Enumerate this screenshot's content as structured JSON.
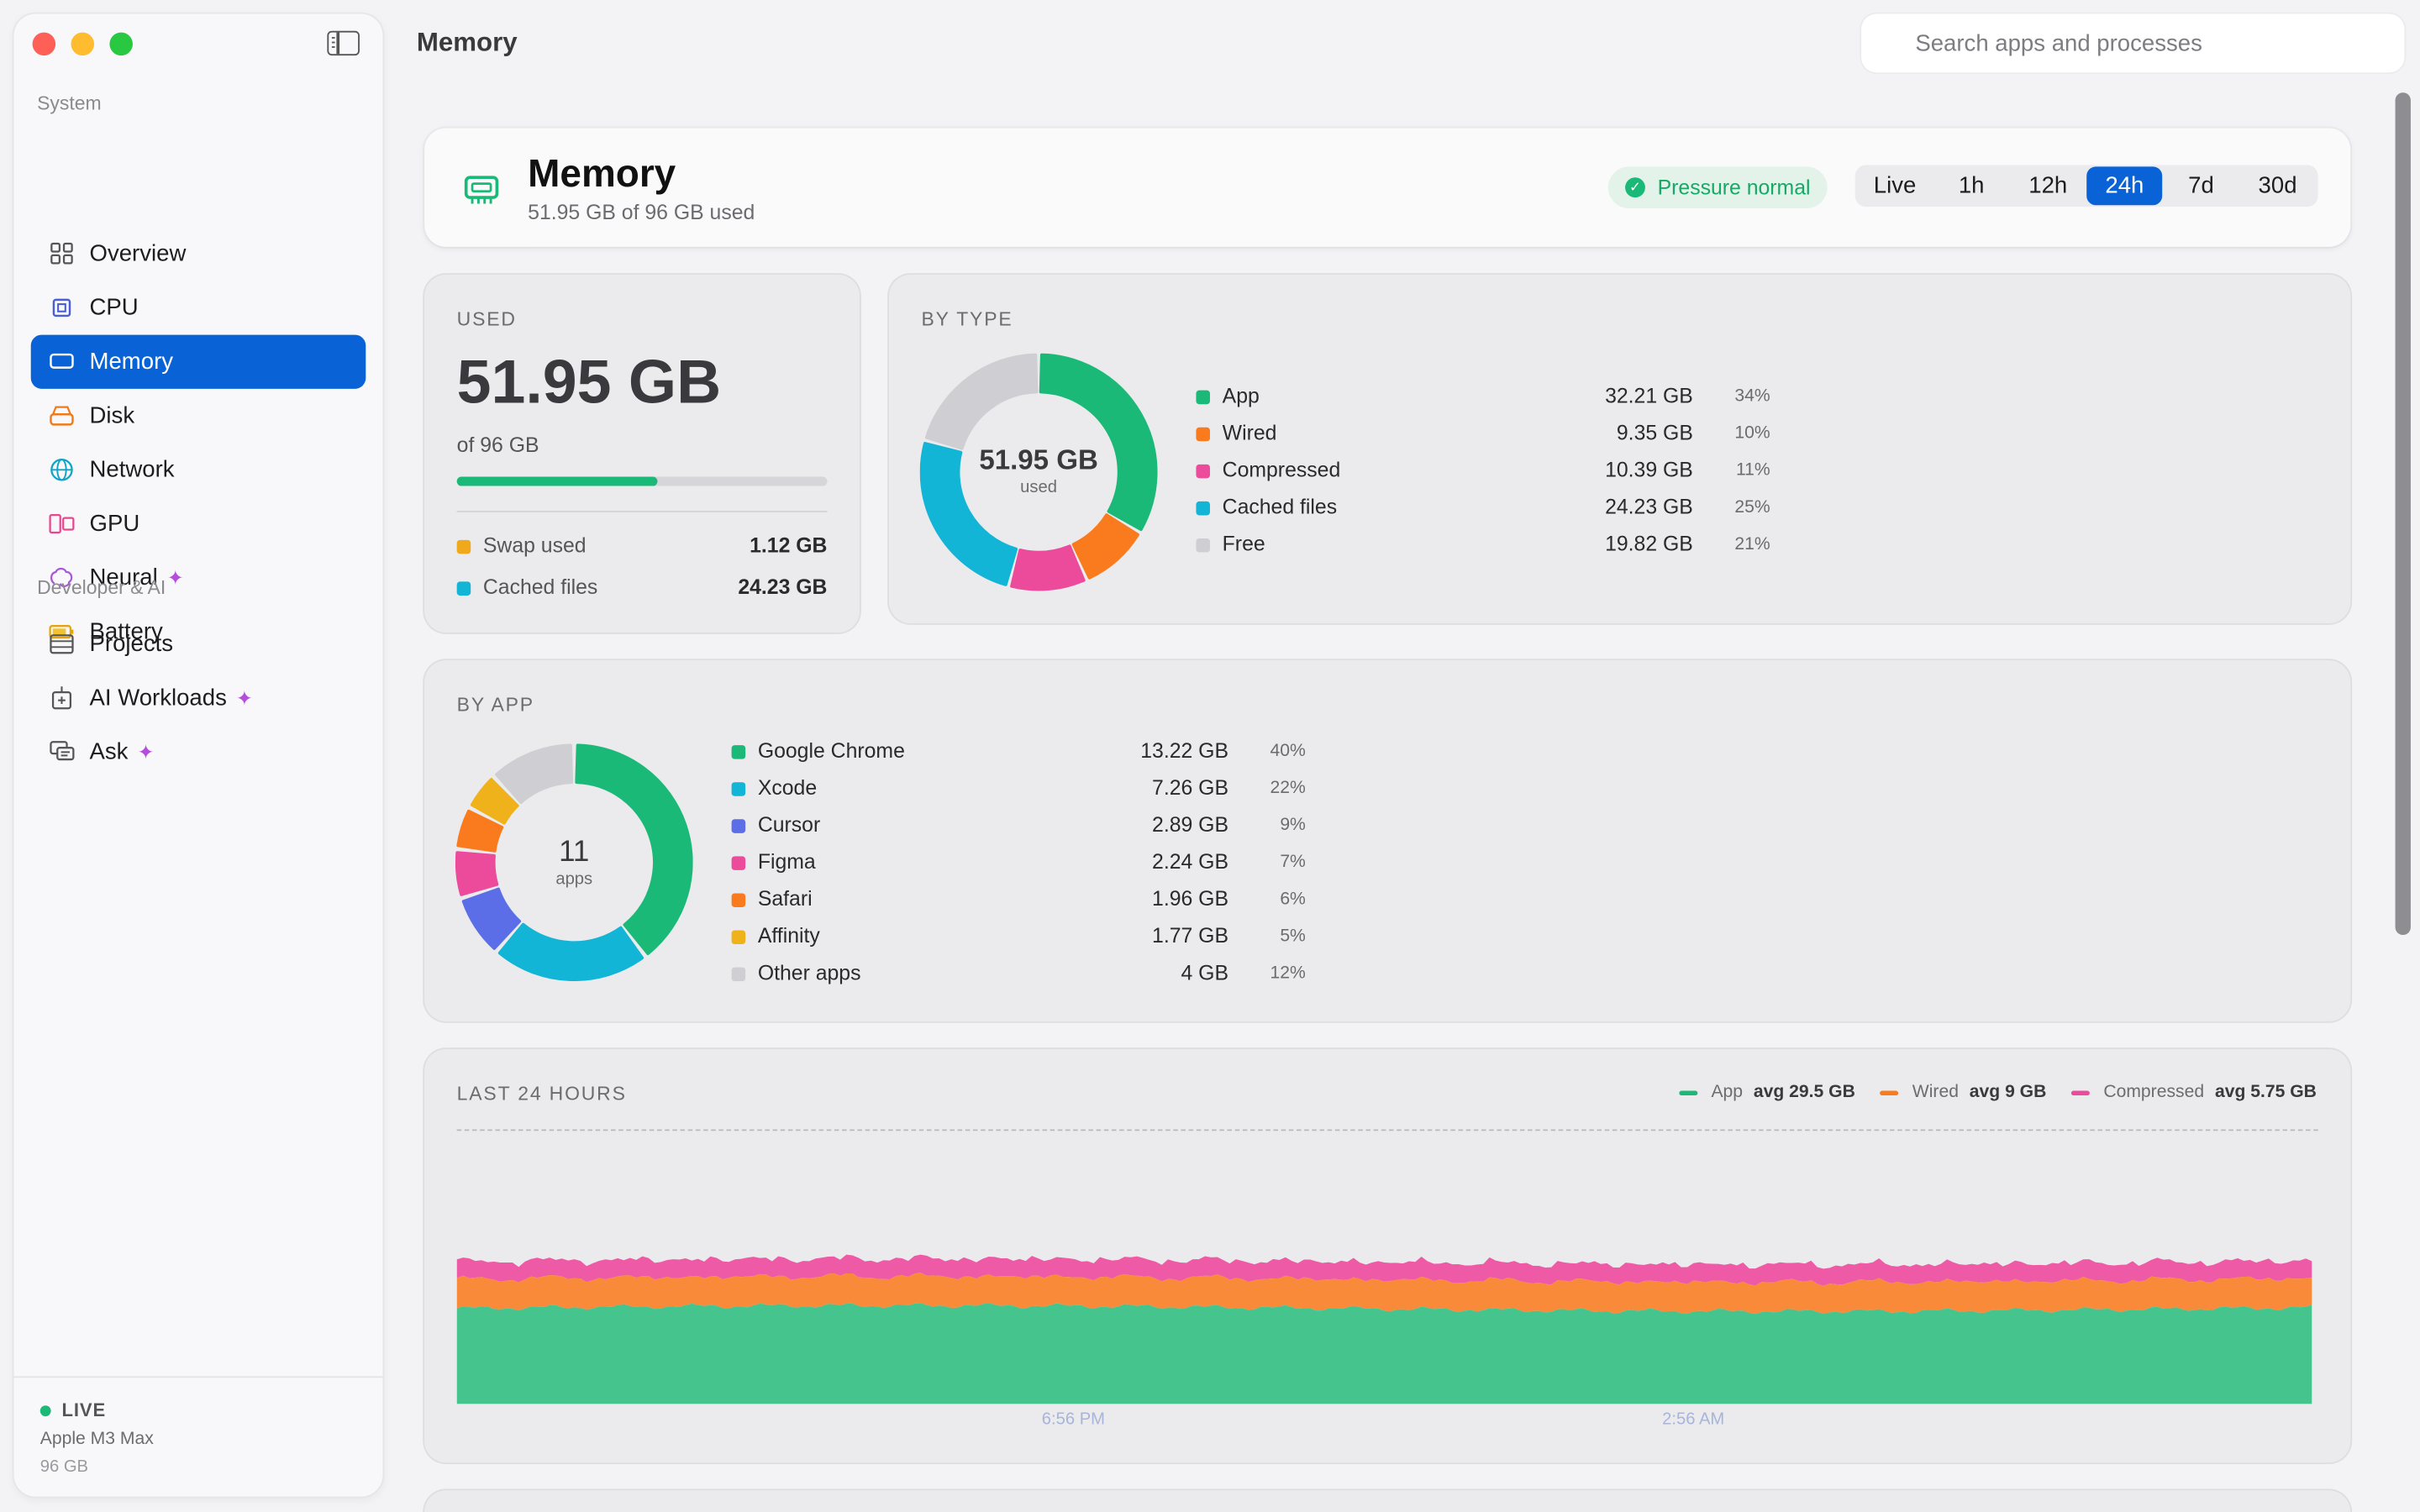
{
  "page_title": "Memory",
  "search": {
    "placeholder": "Search apps and processes"
  },
  "sidebar": {
    "sections": [
      "System",
      "Developer & AI"
    ],
    "system_items": [
      {
        "label": "Overview",
        "icon": "grid-icon"
      },
      {
        "label": "CPU",
        "icon": "cpu-icon"
      },
      {
        "label": "Memory",
        "icon": "memory-icon",
        "active": true
      },
      {
        "label": "Disk",
        "icon": "disk-icon"
      },
      {
        "label": "Network",
        "icon": "globe-icon"
      },
      {
        "label": "GPU",
        "icon": "gpu-icon"
      },
      {
        "label": "Neural",
        "icon": "brain-icon",
        "sparkle": "✦"
      },
      {
        "label": "Battery",
        "icon": "battery-icon"
      }
    ],
    "dev_items": [
      {
        "label": "Projects",
        "icon": "projects-icon"
      },
      {
        "label": "AI Workloads",
        "icon": "ai-workloads-icon",
        "sparkle": "✦"
      },
      {
        "label": "Ask",
        "icon": "chat-icon",
        "sparkle": "✦"
      }
    ],
    "footer": {
      "status": "LIVE",
      "chip": "Apple M3 Max",
      "ram": "96 GB"
    }
  },
  "hero": {
    "title": "Memory",
    "subtitle": "51.95 GB of 96 GB used",
    "pressure": "Pressure normal",
    "ranges": [
      "Live",
      "1h",
      "12h",
      "24h",
      "7d",
      "30d"
    ],
    "selected_range": "24h"
  },
  "used_card": {
    "label": "USED",
    "value": "51.95 GB",
    "of": "of 96 GB",
    "fraction": 0.541,
    "rows": [
      {
        "name": "Swap used",
        "value": "1.12 GB",
        "color": "#f0a91b"
      },
      {
        "name": "Cached files",
        "value": "24.23 GB",
        "color": "#12b5d6"
      }
    ]
  },
  "by_type": {
    "label": "BY TYPE",
    "center_value": "51.95 GB",
    "center_label": "used",
    "items": [
      {
        "name": "App",
        "value": "32.21 GB",
        "pct": "34%",
        "color": "#1bb978",
        "gb": 32.21
      },
      {
        "name": "Wired",
        "value": "9.35 GB",
        "pct": "10%",
        "color": "#f97b1e",
        "gb": 9.35
      },
      {
        "name": "Compressed",
        "value": "10.39 GB",
        "pct": "11%",
        "color": "#ec4b9c",
        "gb": 10.39
      },
      {
        "name": "Cached files",
        "value": "24.23 GB",
        "pct": "25%",
        "color": "#12b5d6",
        "gb": 24.23
      },
      {
        "name": "Free",
        "value": "19.82 GB",
        "pct": "21%",
        "color": "#cfcfd3",
        "gb": 19.82
      }
    ]
  },
  "by_app": {
    "label": "BY APP",
    "center_value": "11",
    "center_label": "apps",
    "items": [
      {
        "name": "Google Chrome",
        "value": "13.22 GB",
        "pct": "40%",
        "color": "#1bb978",
        "gb": 13.22
      },
      {
        "name": "Xcode",
        "value": "7.26 GB",
        "pct": "22%",
        "color": "#12b5d6",
        "gb": 7.26
      },
      {
        "name": "Cursor",
        "value": "2.89 GB",
        "pct": "9%",
        "color": "#5b6ee8",
        "gb": 2.89
      },
      {
        "name": "Figma",
        "value": "2.24 GB",
        "pct": "7%",
        "color": "#ec4b9c",
        "gb": 2.24
      },
      {
        "name": "Safari",
        "value": "1.96 GB",
        "pct": "6%",
        "color": "#f97b1e",
        "gb": 1.96
      },
      {
        "name": "Affinity",
        "value": "1.77 GB",
        "pct": "5%",
        "color": "#f0b21b",
        "gb": 1.77
      },
      {
        "name": "Other apps",
        "value": "4 GB",
        "pct": "12%",
        "color": "#cfcfd3",
        "gb": 4
      }
    ]
  },
  "chart_data": {
    "type": "area",
    "title": "LAST 24 HOURS",
    "x_ticks": [
      "6:56 PM",
      "2:56 AM"
    ],
    "series": [
      {
        "name": "App",
        "avg": "avg 29.5 GB",
        "color": "#46c48e",
        "avg_gb": 29.5
      },
      {
        "name": "Wired",
        "avg": "avg 9 GB",
        "color": "#f98a3a",
        "avg_gb": 9
      },
      {
        "name": "Compressed",
        "avg": "avg 5.75 GB",
        "color": "#ee5aa6",
        "avg_gb": 5.75
      }
    ],
    "stacked": true,
    "grid": false
  }
}
